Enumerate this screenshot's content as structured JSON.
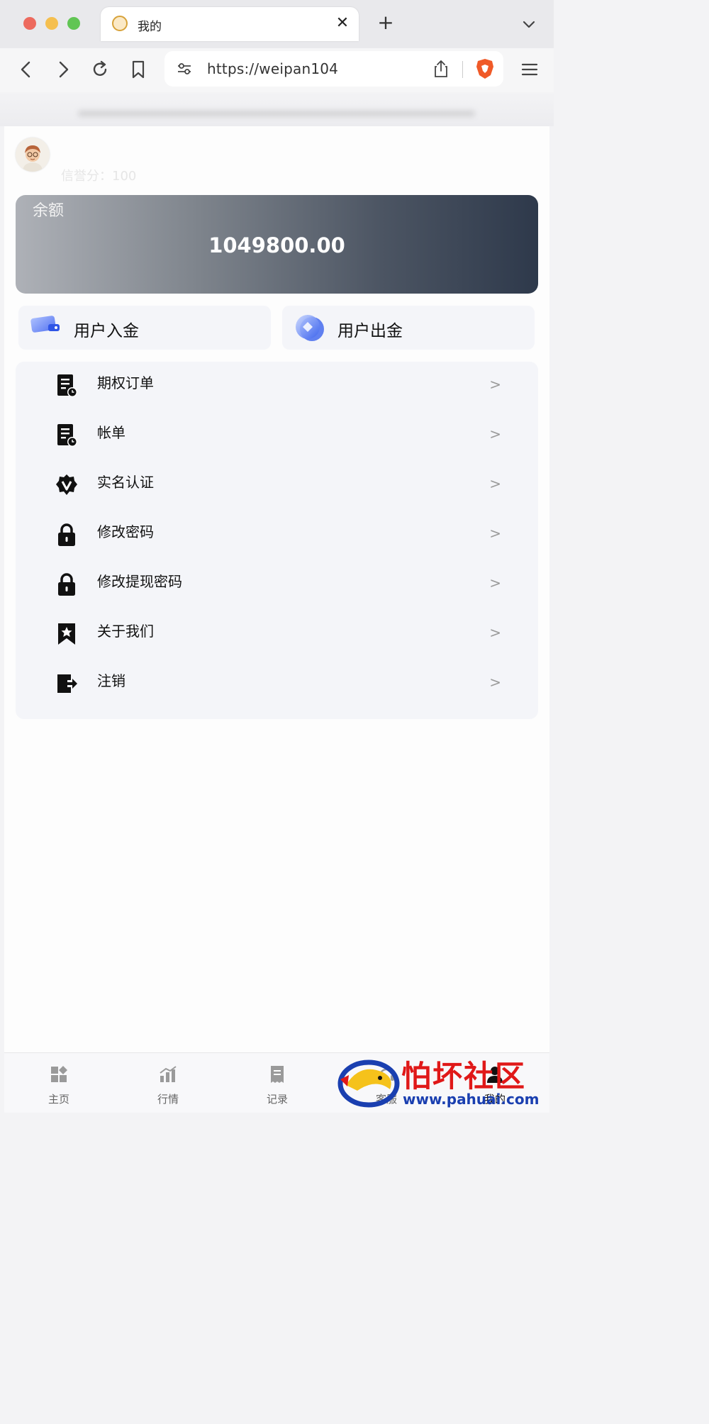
{
  "browser": {
    "tab_title": "我的",
    "url": "https://weipan104"
  },
  "profile": {
    "credit_text": "信誉分：100"
  },
  "balance": {
    "label": "余额",
    "value": "1049800.00"
  },
  "actions": [
    {
      "label": "用户入金",
      "icon": "card-icon"
    },
    {
      "label": "用户出金",
      "icon": "coin-icon"
    }
  ],
  "menu": [
    {
      "label": "期权订单",
      "icon": "order-icon",
      "arrow": ">"
    },
    {
      "label": "帐单",
      "icon": "bill-icon",
      "arrow": ">"
    },
    {
      "label": "实名认证",
      "icon": "verify-badge-icon",
      "arrow": ">"
    },
    {
      "label": "修改密码",
      "icon": "lock-icon",
      "arrow": ">"
    },
    {
      "label": "修改提现密码",
      "icon": "lock-icon",
      "arrow": ">"
    },
    {
      "label": "关于我们",
      "icon": "bookmark-star-icon",
      "arrow": ">"
    },
    {
      "label": "注销",
      "icon": "logout-icon",
      "arrow": ">"
    }
  ],
  "bottom_nav": [
    {
      "label": "主页",
      "icon": "home-icon"
    },
    {
      "label": "行情",
      "icon": "chart-icon"
    },
    {
      "label": "记录",
      "icon": "receipt-icon"
    },
    {
      "label": "客服",
      "icon": "service-icon"
    },
    {
      "label": "我的",
      "icon": "user-icon"
    }
  ],
  "watermark": {
    "text": "怕坏社区",
    "url": "www.pahuai.com"
  },
  "colors": {
    "balance_gradient_start": "#aeb1b7",
    "balance_gradient_end": "#2e394b",
    "watermark_red": "#e01818",
    "watermark_blue": "#1a3fb0"
  }
}
